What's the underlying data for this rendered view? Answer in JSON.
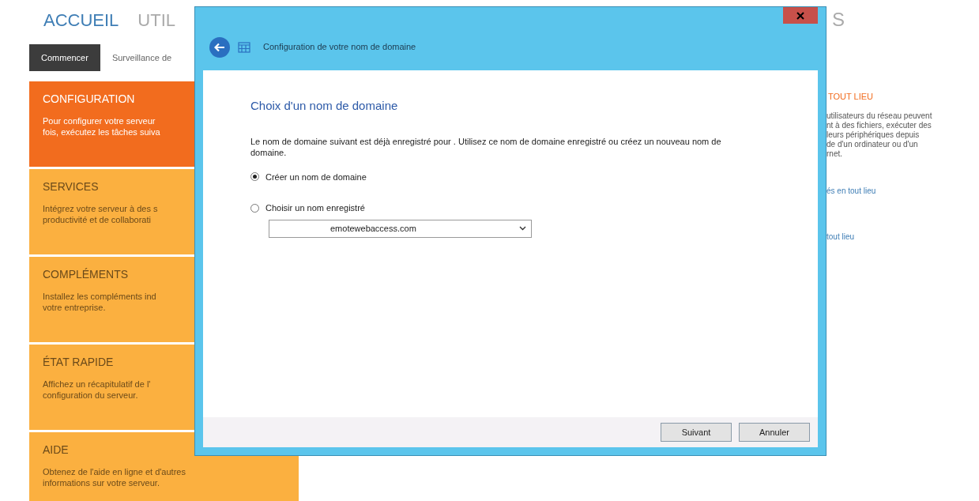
{
  "nav": [
    {
      "label": "ACCUEIL",
      "selected": true
    },
    {
      "label": "UTIL",
      "selected": false
    }
  ],
  "nav_tail": "S",
  "tabs": [
    {
      "label": "Commencer",
      "selected": true
    },
    {
      "label": "Surveillance de",
      "selected": false
    }
  ],
  "tiles": [
    {
      "title": "CONFIGURATION",
      "selected": true,
      "lines": [
        "Pour configurer votre serveur",
        "fois, exécutez les tâches suiva"
      ]
    },
    {
      "title": "SERVICES",
      "selected": false,
      "lines": [
        "Intégrez votre serveur à des s",
        "productivité et de collaborati"
      ]
    },
    {
      "title": "COMPLÉMENTS",
      "selected": false,
      "lines": [
        "Installez les compléments ind",
        "votre entreprise."
      ]
    },
    {
      "title": "ÉTAT RAPIDE",
      "selected": false,
      "lines": [
        "Affichez un récapitulatif de l'",
        "configuration du serveur."
      ]
    },
    {
      "title": "AIDE",
      "selected": false,
      "lines": [
        "Obtenez de l'aide en ligne et d'autres",
        "informations sur votre serveur."
      ]
    }
  ],
  "right_panel": {
    "title": "TOUT LIEU",
    "lines": [
      "utilisateurs du réseau peuvent",
      "nt à des fichiers, exécuter des",
      "leurs périphériques depuis",
      "de d'un ordinateur ou d'un",
      "rnet."
    ],
    "links": [
      "és en tout lieu",
      "tout lieu"
    ]
  },
  "dialog": {
    "title": "Configuration de votre nom de domaine",
    "heading": "Choix d'un nom de domaine",
    "description": "Le nom de domaine suivant est déjà enregistré pour . Utilisez ce nom de domaine enregistré ou créez un nouveau nom de domaine.",
    "options": [
      {
        "label": "Créer un nom de domaine",
        "selected": true
      },
      {
        "label": "Choisir un nom enregistré",
        "selected": false
      }
    ],
    "dropdown": {
      "value": "emotewebaccess.com"
    },
    "buttons": [
      "Suivant",
      "Annuler"
    ]
  }
}
